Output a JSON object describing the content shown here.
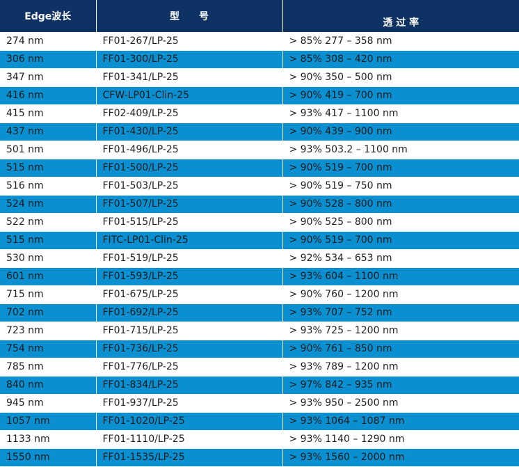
{
  "header": {
    "edge": "Edge波长",
    "model": "型　　号",
    "transmission": "透 过 率"
  },
  "rows": [
    {
      "edge": "274 nm",
      "model": "FF01-267/LP-25",
      "transmission": "> 85% 277 – 358 nm"
    },
    {
      "edge": "306 nm",
      "model": "FF01-300/LP-25",
      "transmission": "> 85% 308 – 420 nm"
    },
    {
      "edge": "347 nm",
      "model": "FF01-341/LP-25",
      "transmission": "> 90% 350 – 500 nm"
    },
    {
      "edge": "416 nm",
      "model": "CFW-LP01-Clin-25",
      "transmission": "> 90% 419 – 700 nm"
    },
    {
      "edge": "415 nm",
      "model": "FF02-409/LP-25",
      "transmission": "> 93% 417 – 1100 nm"
    },
    {
      "edge": "437 nm",
      "model": "FF01-430/LP-25",
      "transmission": "> 90% 439 – 900 nm"
    },
    {
      "edge": "501 nm",
      "model": "FF01-496/LP-25",
      "transmission": "> 93% 503.2 – 1100 nm"
    },
    {
      "edge": "515 nm",
      "model": "FF01-500/LP-25",
      "transmission": "> 90% 519 – 700 nm"
    },
    {
      "edge": "516 nm",
      "model": "FF01-503/LP-25",
      "transmission": "> 90% 519 – 750 nm"
    },
    {
      "edge": "524 nm",
      "model": "FF01-507/LP-25",
      "transmission": "> 90% 528 – 800 nm"
    },
    {
      "edge": "522 nm",
      "model": "FF01-515/LP-25",
      "transmission": "> 90% 525 – 800 nm"
    },
    {
      "edge": "515 nm",
      "model": "FITC-LP01-Clin-25",
      "transmission": "> 90% 519 – 700 nm"
    },
    {
      "edge": "530 nm",
      "model": "FF01-519/LP-25",
      "transmission": "> 92% 534 – 653 nm"
    },
    {
      "edge": "601 nm",
      "model": "FF01-593/LP-25",
      "transmission": "> 93% 604 – 1100 nm"
    },
    {
      "edge": "715 nm",
      "model": "FF01-675/LP-25",
      "transmission": "> 90% 760 – 1200 nm"
    },
    {
      "edge": "702 nm",
      "model": "FF01-692/LP-25",
      "transmission": "> 93% 707 – 752 nm"
    },
    {
      "edge": "723 nm",
      "model": "FF01-715/LP-25",
      "transmission": "> 93% 725 – 1200 nm"
    },
    {
      "edge": "754 nm",
      "model": "FF01-736/LP-25",
      "transmission": "> 90% 761 – 850 nm"
    },
    {
      "edge": "785 nm",
      "model": "FF01-776/LP-25",
      "transmission": "> 93% 789 – 1200 nm"
    },
    {
      "edge": "840 nm",
      "model": "FF01-834/LP-25",
      "transmission": "> 97% 842 – 935 nm"
    },
    {
      "edge": "945 nm",
      "model": "FF01-937/LP-25",
      "transmission": "> 93% 950 – 2500 nm"
    },
    {
      "edge": "1057 nm",
      "model": "FF01-1020/LP-25",
      "transmission": "> 93% 1064 – 1087 nm"
    },
    {
      "edge": "1133 nm",
      "model": "FF01-1110/LP-25",
      "transmission": "> 93% 1140 – 1290 nm"
    },
    {
      "edge": "1550 nm",
      "model": "FF01-1535/LP-25",
      "transmission": "> 93% 1560 – 2000 nm"
    }
  ]
}
